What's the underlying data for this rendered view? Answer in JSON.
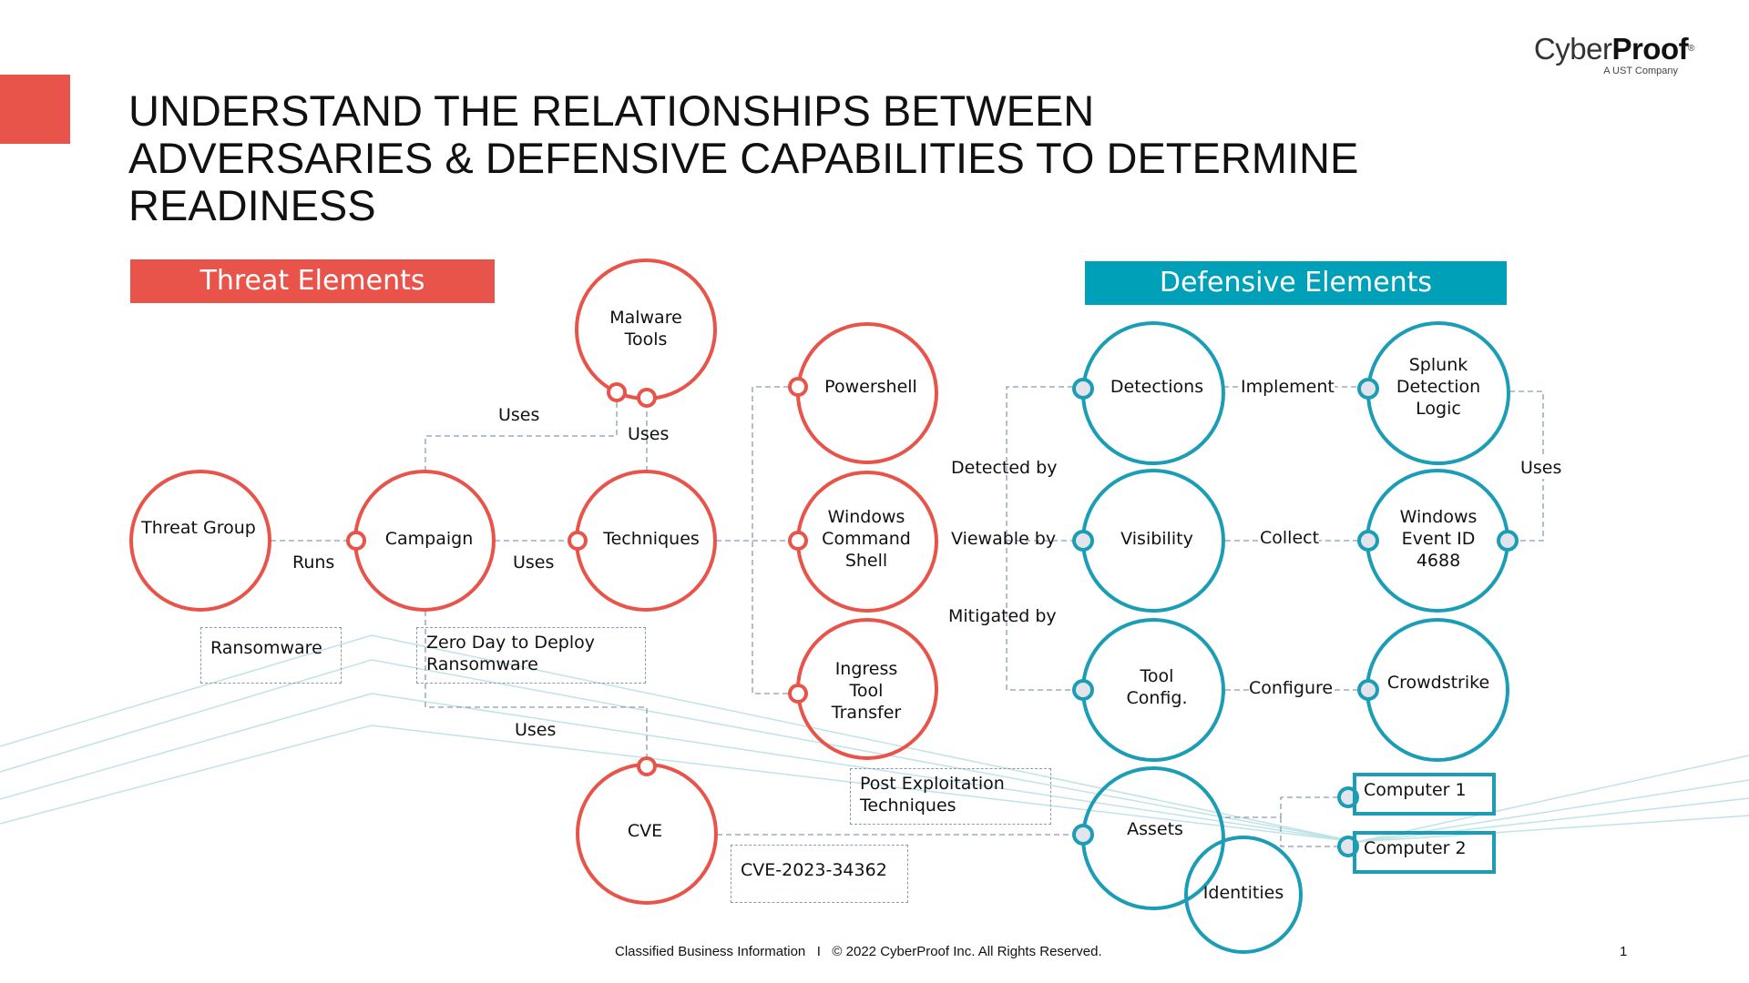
{
  "slide": {
    "title_lines": [
      "UNDERSTAND THE RELATIONSHIPS BETWEEN",
      "ADVERSARIES & DEFENSIVE CAPABILITIES TO DETERMINE",
      "READINESS"
    ],
    "logo": {
      "name_light": "Cyber",
      "name_bold": "Proof",
      "registered": "®",
      "tagline": "A UST Company"
    },
    "footer": "Classified Business Information   I   © 2022 CyberProof Inc. All Rights Reserved.",
    "page_number": "1"
  },
  "colors": {
    "threat": "#e8534a",
    "defense": "#1a9db5",
    "banner_defense": "#00a0b8",
    "connector": "#8a9bb0",
    "decor": "#bfe3e6",
    "handle_fill_defense": "#e1e4ea"
  },
  "sections": {
    "threat_title": "Threat Elements",
    "defense_title": "Defensive Elements"
  },
  "threat_nodes": {
    "threat_group": "Threat Group",
    "campaign": "Campaign",
    "techniques": "Techniques",
    "malware_tools": "Malware\nTools",
    "cve": "CVE",
    "powershell": "Powershell",
    "windows_command_shell": "Windows\nCommand\nShell",
    "ingress_tool_transfer": "Ingress\nTool\nTransfer"
  },
  "defense_nodes": {
    "detections": "Detections",
    "visibility": "Visibility",
    "tool_config": "Tool\nConfig.",
    "assets": "Assets",
    "identities": "Identities",
    "splunk": "Splunk\nDetection\nLogic",
    "windows_event": "Windows\nEvent ID\n4688",
    "crowdstrike": "Crowdstrike",
    "computer1": "Computer 1",
    "computer2": "Computer 2"
  },
  "edge_labels": {
    "runs": "Runs",
    "campaign_uses_techniques": "Uses",
    "campaign_uses_malware": "Uses",
    "techniques_uses_malware": "Uses",
    "campaign_uses_cve": "Uses",
    "detected_by": "Detected by",
    "viewable_by": "Viewable by",
    "mitigated_by": "Mitigated by",
    "implement": "Implement",
    "collect": "Collect",
    "configure": "Configure",
    "splunk_uses_event": "Uses"
  },
  "notes": {
    "ransomware": "Ransomware",
    "zero_day": "Zero Day to Deploy\nRansomware",
    "post_exploitation": "Post Exploitation\nTechniques",
    "cve_id": "CVE-2023-34362"
  }
}
